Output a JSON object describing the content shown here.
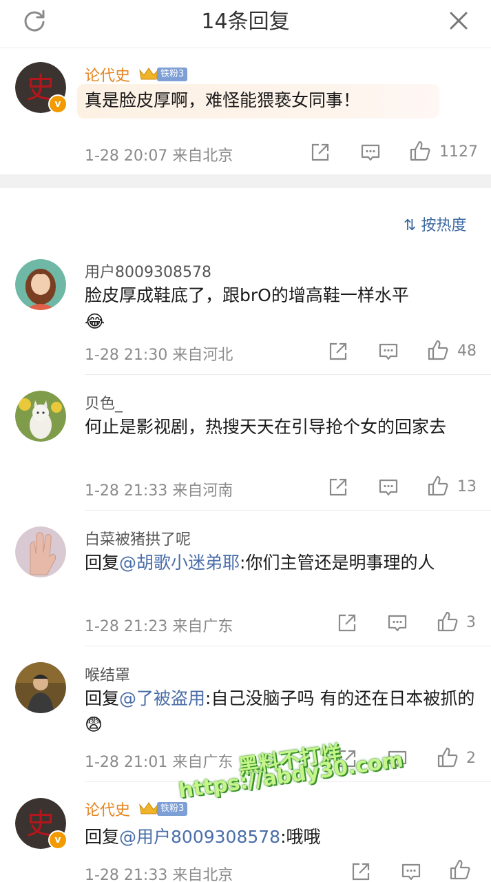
{
  "header": {
    "title": "14条回复",
    "refresh_icon": "refresh-icon",
    "close_icon": "close-icon"
  },
  "root_comment": {
    "author": "论代史",
    "avatar_char": "史",
    "fan_badge": "铁粉3",
    "text": "真是脸皮厚啊，难怪能猥亵女同事！",
    "time": "1-28 20:07 来自北京",
    "likes": "1127"
  },
  "sort_label": "按热度",
  "replies": [
    {
      "author": "用户8009308578",
      "text": "脸皮厚成鞋底了，跟brO的增高鞋一样水平",
      "emoji": "😂",
      "time": "1-28 21:30 来自河北",
      "likes": "48"
    },
    {
      "author": "贝色_",
      "text": "何止是影视剧，热搜天天在引导抢个女的回家去",
      "time": "1-28 21:33 来自河南",
      "likes": "13"
    },
    {
      "author": "白菜被猪拱了呢",
      "reply_prefix": "回复",
      "mention": "@胡歌小迷弟耶",
      "text": ":你们主管还是明事理的人",
      "time": "1-28 21:23 来自广东",
      "likes": "3"
    },
    {
      "author": "喉结罩",
      "reply_prefix": "回复",
      "mention": "@了被盗用",
      "text": ":自己没脑子吗 有的还在日本被抓的",
      "emoji": "😨",
      "time": "1-28 21:01 来自广东",
      "likes": "2"
    },
    {
      "author": "论代史",
      "avatar_char": "史",
      "fan_badge": "铁粉3",
      "reply_prefix": "回复",
      "mention": "@用户8009308578",
      "text": ":哦哦",
      "time": "1-28 21:33 来自北京",
      "likes": ""
    }
  ],
  "watermark": {
    "line1": "黑料不打烊",
    "line2": "https://abdy30.com"
  },
  "colors": {
    "accent_gold": "#e48622",
    "link_blue": "#4a6ea9",
    "meta_gray": "#8a8a8a",
    "vip_badge": "#f29a00"
  }
}
